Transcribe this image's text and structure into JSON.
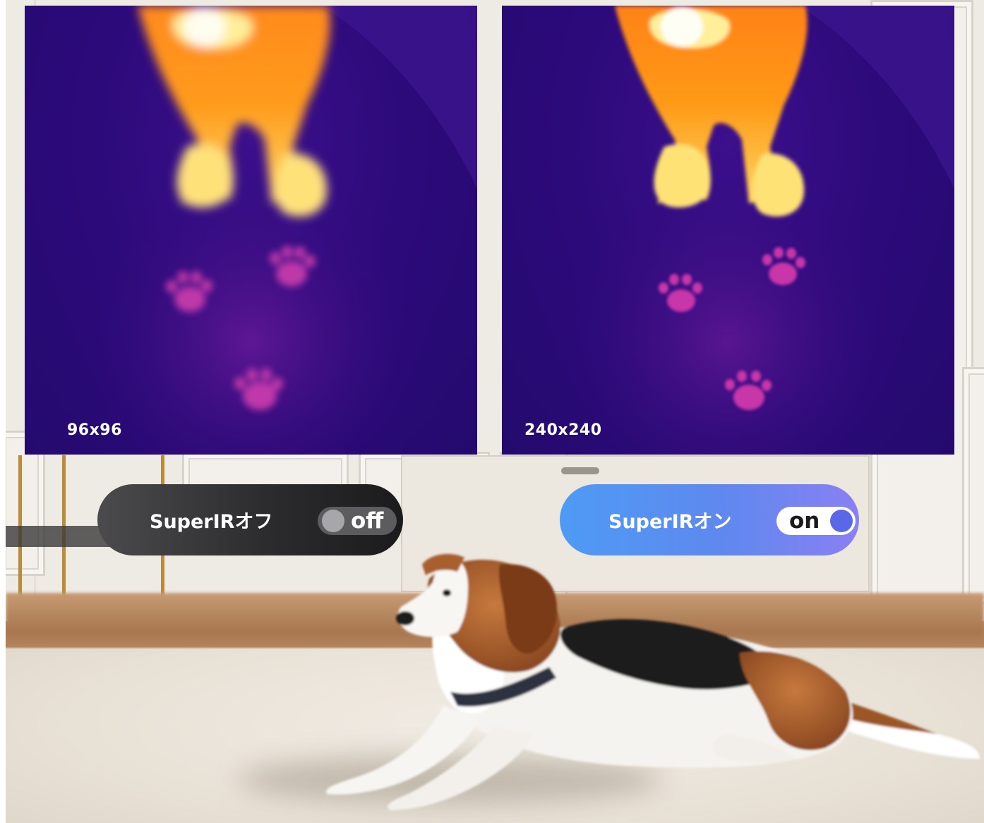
{
  "thermal_images": [
    {
      "resolution_label": "96x96"
    },
    {
      "resolution_label": "240x240"
    }
  ],
  "toggles": [
    {
      "label": "SuperIRオフ",
      "state_text": "off",
      "state": false
    },
    {
      "label": "SuperIRオン",
      "state_text": "on",
      "state": true
    }
  ],
  "colors": {
    "off_pill": "#2c2c2e",
    "on_pill_start": "#4d9bf4",
    "on_pill_end": "#8a80f3",
    "on_knob": "#5a67e6",
    "thermal_bg": "#2c0a7a"
  }
}
